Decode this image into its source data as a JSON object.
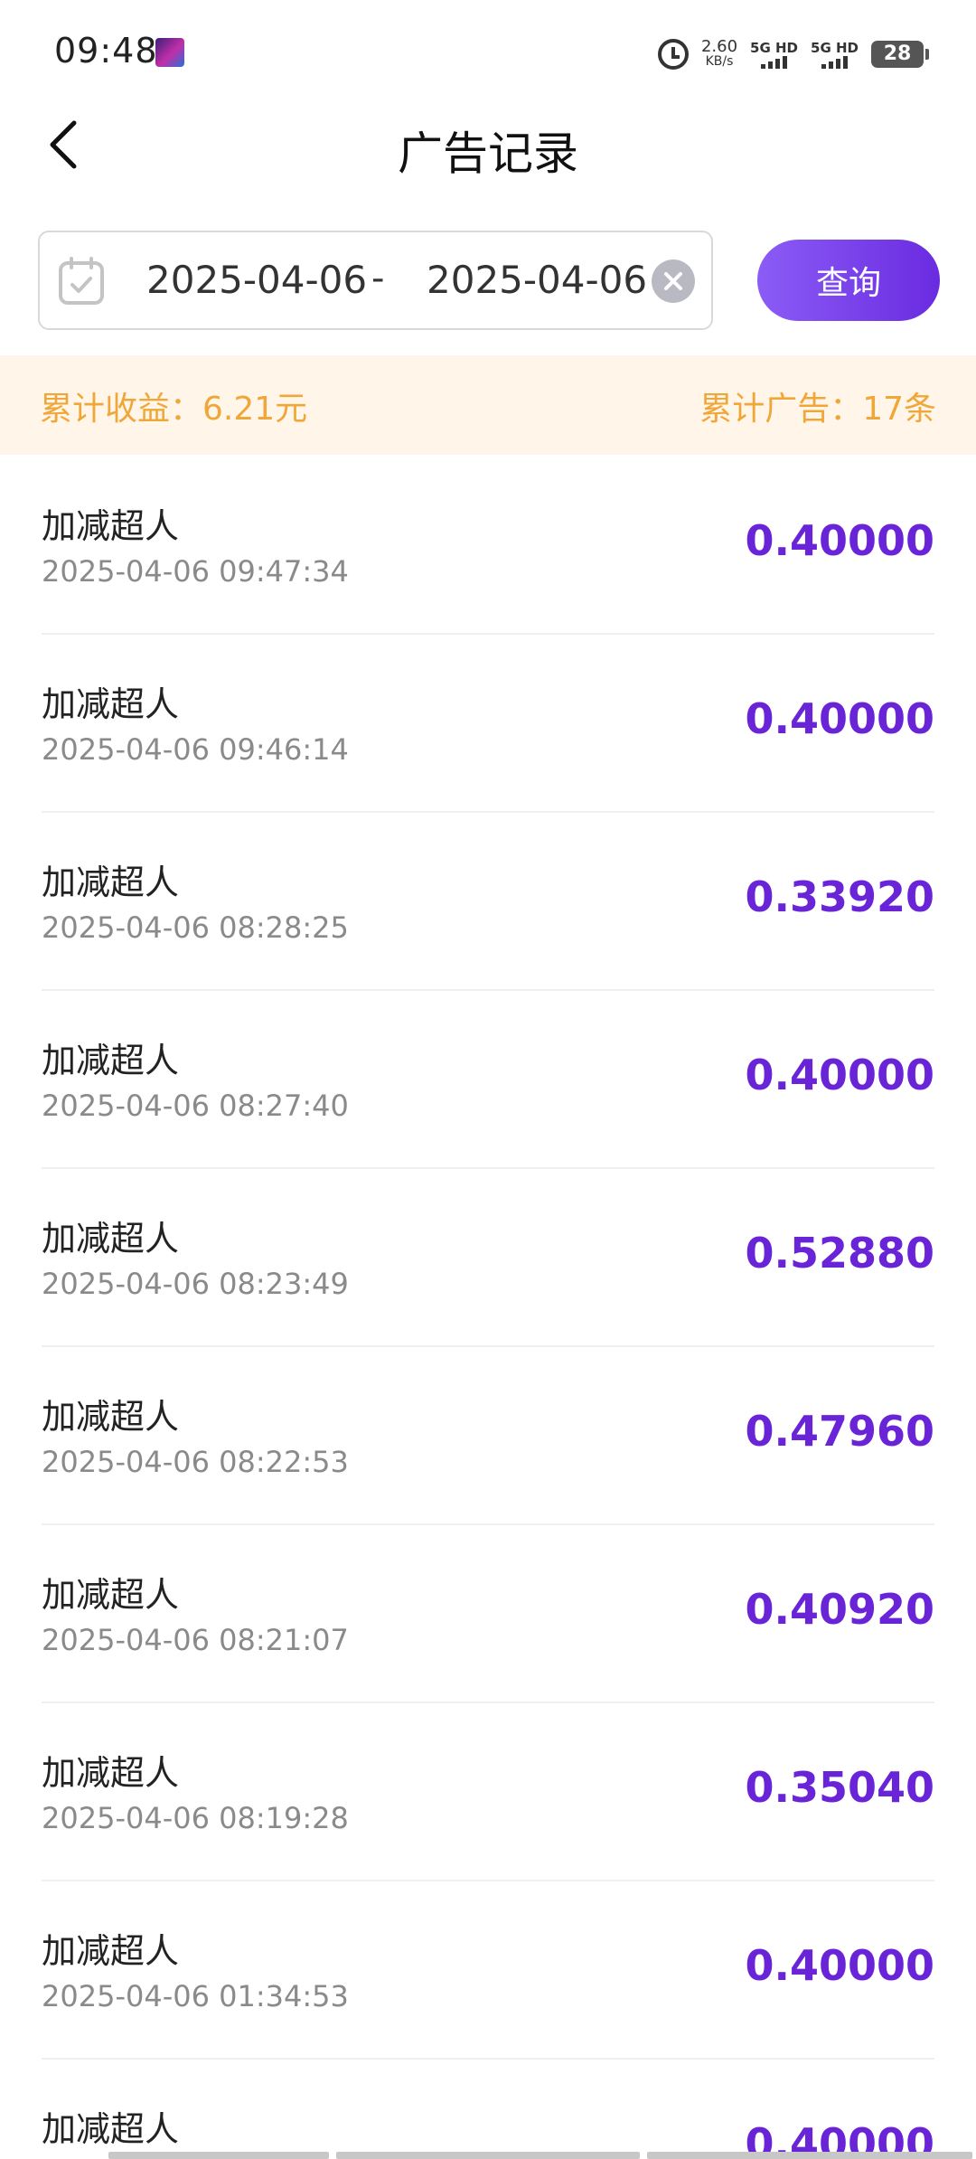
{
  "status_bar": {
    "time": "09:48",
    "net_speed_value": "2.60",
    "net_speed_unit": "KB/s",
    "sim1_label": "5G HD",
    "sim2_label": "5G HD",
    "battery": "28"
  },
  "nav": {
    "title": "广告记录"
  },
  "search": {
    "start_date": "2025-04-06",
    "separator": "-",
    "end_date": "2025-04-06",
    "query_label": "查询"
  },
  "summary": {
    "income": "累计收益：6.21元",
    "ad_count": "累计广告：17条"
  },
  "records": [
    {
      "name": "加减超人",
      "time": "2025-04-06 09:47:34",
      "amount": "0.40000"
    },
    {
      "name": "加减超人",
      "time": "2025-04-06 09:46:14",
      "amount": "0.40000"
    },
    {
      "name": "加减超人",
      "time": "2025-04-06 08:28:25",
      "amount": "0.33920"
    },
    {
      "name": "加减超人",
      "time": "2025-04-06 08:27:40",
      "amount": "0.40000"
    },
    {
      "name": "加减超人",
      "time": "2025-04-06 08:23:49",
      "amount": "0.52880"
    },
    {
      "name": "加减超人",
      "time": "2025-04-06 08:22:53",
      "amount": "0.47960"
    },
    {
      "name": "加减超人",
      "time": "2025-04-06 08:21:07",
      "amount": "0.40920"
    },
    {
      "name": "加减超人",
      "time": "2025-04-06 08:19:28",
      "amount": "0.35040"
    },
    {
      "name": "加减超人",
      "time": "2025-04-06 01:34:53",
      "amount": "0.40000"
    },
    {
      "name": "加减超人",
      "time": "",
      "amount": "0.40000"
    }
  ],
  "colors": {
    "accent": "#6a24d8",
    "summary_text": "#f0a73a",
    "summary_bg": "#fff5e8"
  }
}
